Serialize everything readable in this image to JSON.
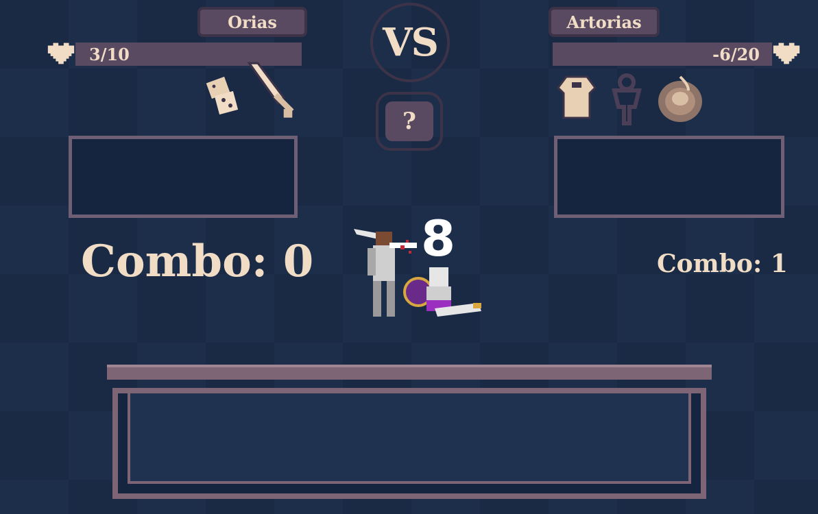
{
  "player": {
    "name": "Orias",
    "hp": "3/10",
    "combo": "Combo: 0"
  },
  "opponent": {
    "name": "Artorias",
    "hp": "-6/20",
    "combo": "Combo: 1"
  },
  "center": {
    "vs": "VS",
    "mystery": "?"
  },
  "battle": {
    "damage": "8"
  },
  "colors": {
    "background": "#1a2a44",
    "panel": "#594a62",
    "text": "#f1ddc6",
    "border": "#7d6576"
  }
}
